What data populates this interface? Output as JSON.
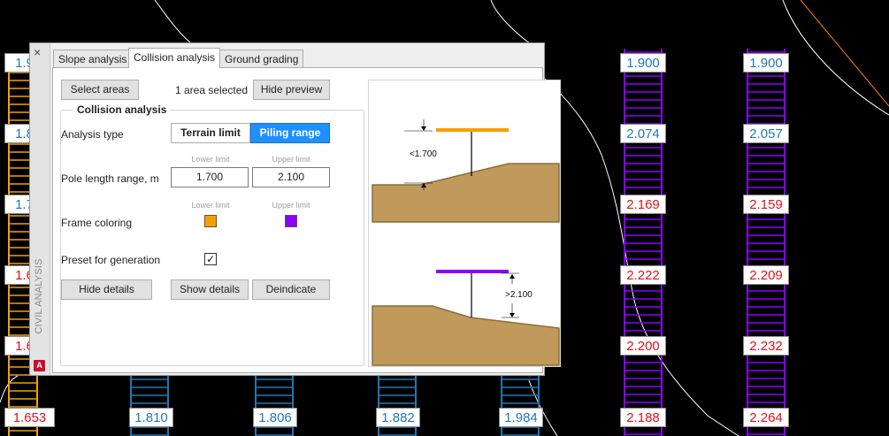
{
  "window": {
    "vertical_title": "CIVIL ANALYSIS",
    "close_glyph": "×",
    "app_badge": "A"
  },
  "tabs": [
    {
      "label": "Slope analysis",
      "active": false
    },
    {
      "label": "Collision analysis",
      "active": true
    },
    {
      "label": "Ground grading",
      "active": false
    }
  ],
  "top": {
    "select_areas": "Select areas",
    "selection_status": "1 area selected",
    "hide_preview": "Hide preview"
  },
  "group": {
    "title": "Collision analysis",
    "analysis_type_label": "Analysis type",
    "terrain_limit": "Terrain limit",
    "piling_range": "Piling range",
    "piling_range_active": true,
    "lower_limit_caption": "Lower limit",
    "upper_limit_caption": "Upper limit",
    "pole_length_label": "Pole length range, m",
    "pole_lower_value": "1.700",
    "pole_upper_value": "2.100",
    "frame_coloring_label": "Frame coloring",
    "lower_color": "#f5a000",
    "upper_color": "#8b00ff",
    "preset_label": "Preset for generation",
    "preset_checked": true,
    "hide_details": "Hide details",
    "show_details": "Show details",
    "deindicate": "Deindicate"
  },
  "preview": {
    "top_diagram_label": "<1.700",
    "bottom_diagram_label": ">2.100",
    "terrain_color": "#bf9a5a",
    "orange_bar_color": "#f5a000",
    "purple_bar_color": "#8b00ff"
  },
  "drawing_labels": [
    {
      "text": "1.9",
      "color": "blue"
    },
    {
      "text": "1.8",
      "color": "blue"
    },
    {
      "text": "1.7",
      "color": "blue"
    },
    {
      "text": "1.6",
      "color": "red"
    },
    {
      "text": "1.6",
      "color": "red"
    },
    {
      "text": "1.653",
      "color": "red"
    },
    {
      "text": "1.810",
      "color": "blue"
    },
    {
      "text": "1.806",
      "color": "blue"
    },
    {
      "text": "1.882",
      "color": "blue"
    },
    {
      "text": "1.984",
      "color": "blue"
    },
    {
      "text": "1.900",
      "color": "blue"
    },
    {
      "text": "2.074",
      "color": "blue"
    },
    {
      "text": "2.169",
      "color": "red"
    },
    {
      "text": "2.222",
      "color": "red"
    },
    {
      "text": "2.200",
      "color": "red"
    },
    {
      "text": "2.188",
      "color": "red"
    },
    {
      "text": "1.900",
      "color": "blue"
    },
    {
      "text": "2.057",
      "color": "blue"
    },
    {
      "text": "2.159",
      "color": "red"
    },
    {
      "text": "2.209",
      "color": "red"
    },
    {
      "text": "2.232",
      "color": "red"
    },
    {
      "text": "2.264",
      "color": "red"
    }
  ],
  "frame_colors": {
    "orange": "#f5a000",
    "cyan": "#1f78b4",
    "purple": "#8b00ff"
  }
}
